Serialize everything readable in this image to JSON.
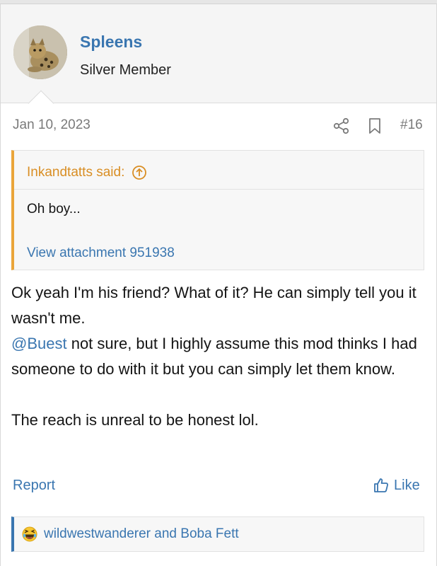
{
  "user": {
    "name": "Spleens",
    "title": "Silver Member"
  },
  "post": {
    "date": "Jan 10, 2023",
    "number": "#16"
  },
  "quote": {
    "author_said": "Inkandtatts said:",
    "text": "Oh boy...",
    "attachment_link": "View attachment 951938"
  },
  "message": {
    "line1": "Ok yeah I'm his friend? What of it? He can simply tell you it wasn't me.",
    "mention": "@Buest",
    "line2": " not sure, but I highly assume this mod thinks I had someone to do with it but you can simply let them know.",
    "line3": "The reach is unreal to be honest lol."
  },
  "actions": {
    "report": "Report",
    "like": "Like"
  },
  "reactions": {
    "users": "wildwestwanderer and Boba Fett"
  },
  "colors": {
    "link": "#3a76b0",
    "quote_accent": "#eaa53a"
  }
}
